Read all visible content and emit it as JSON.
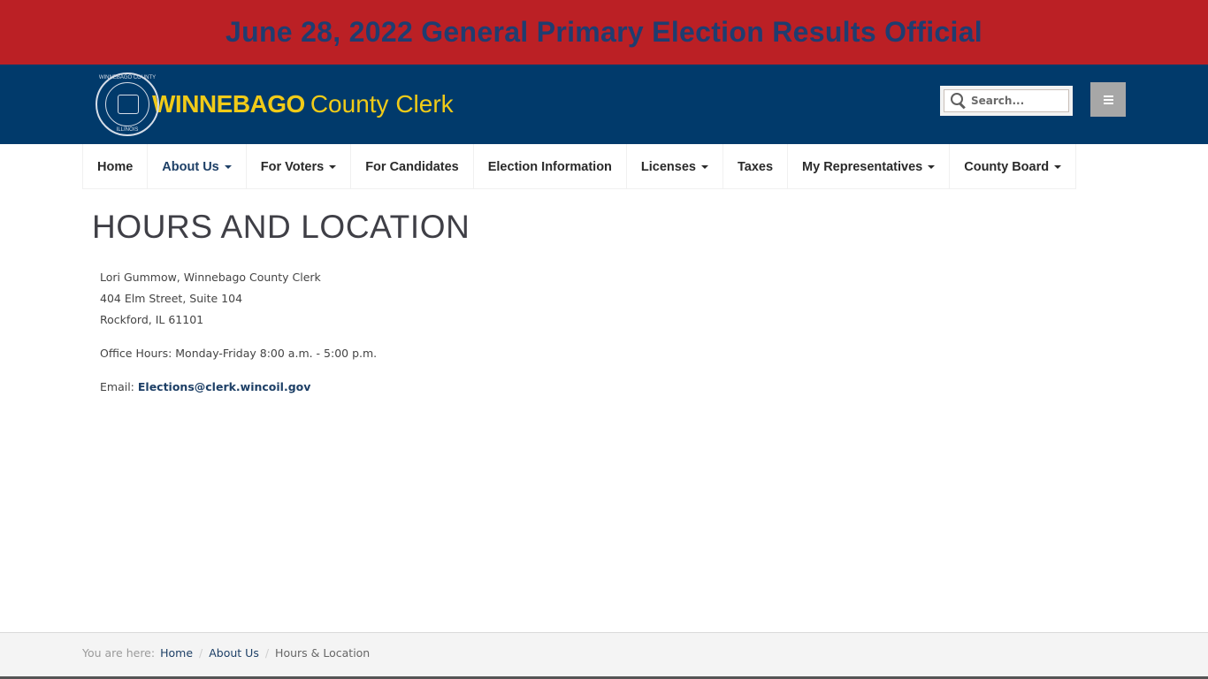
{
  "banner": {
    "text": "June 28, 2022 General Primary Election Results Official"
  },
  "header": {
    "logo": {
      "seal_top": "WINNEBAGO COUNTY",
      "seal_bottom": "ILLINOIS",
      "bold": "WINNEBAGO",
      "light": "County Clerk"
    },
    "search": {
      "placeholder": "Search..."
    },
    "menu_icon": "hamburger-icon"
  },
  "nav": {
    "items": [
      {
        "label": "Home",
        "dropdown": false
      },
      {
        "label": "About Us",
        "dropdown": true,
        "active": true
      },
      {
        "label": "For Voters",
        "dropdown": true
      },
      {
        "label": "For Candidates",
        "dropdown": false
      },
      {
        "label": "Election Information",
        "dropdown": false
      },
      {
        "label": "Licenses",
        "dropdown": true
      },
      {
        "label": "Taxes",
        "dropdown": false
      },
      {
        "label": "My Representatives",
        "dropdown": true
      },
      {
        "label": "County Board",
        "dropdown": true
      }
    ]
  },
  "main": {
    "title": "HOURS AND LOCATION",
    "address": {
      "name": "Lori Gummow, Winnebago County Clerk",
      "street": "404 Elm Street, Suite 104",
      "city": "Rockford, IL 61101"
    },
    "hours": "Office Hours: Monday-Friday 8:00 a.m. - 5:00 p.m.",
    "email_label": "Email: ",
    "email": "Elections@clerk.wincoil.gov"
  },
  "breadcrumb": {
    "label": "You are here:",
    "items": [
      "Home",
      "About Us"
    ],
    "separator": "/",
    "current": "Hours & Location"
  },
  "colors": {
    "banner_bg": "#bb2025",
    "banner_text": "#1f3d70",
    "header_bg": "#013a6b",
    "logo_yellow": "#f1cb18",
    "link": "#1d3f66"
  }
}
